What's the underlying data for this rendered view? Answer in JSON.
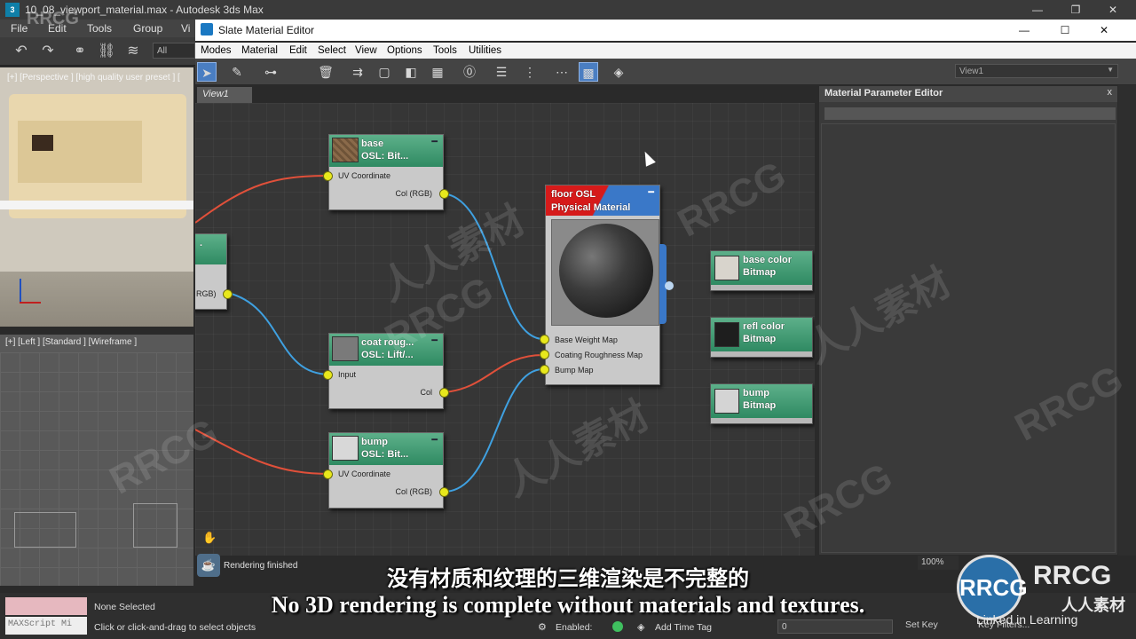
{
  "window": {
    "title": "10_08_viewport_material.max - Autodesk 3ds Max",
    "logo": "3",
    "buttons": {
      "minimize": "—",
      "restore": "❐",
      "close": "✕"
    }
  },
  "max_menu": {
    "file": "File",
    "edit": "Edit",
    "tools": "Tools",
    "group": "Group",
    "views": "Vi"
  },
  "max_toolbar": {
    "selection_filter": "All",
    "icons": [
      "undo-icon",
      "redo-icon",
      "link-icon",
      "unlink-icon",
      "bind-spacewarp-icon"
    ]
  },
  "viewports": {
    "perspective_label": "[+] [Perspective ] [high quality user preset ] [",
    "left_label": "[+] [Left ] [Standard ] [Wireframe ]"
  },
  "slate": {
    "title": "Slate Material Editor",
    "buttons": {
      "minimize": "—",
      "maximize": "☐",
      "close": "✕"
    },
    "menu": [
      "Modes",
      "Material",
      "Edit",
      "Select",
      "View",
      "Options",
      "Tools",
      "Utilities"
    ],
    "view_dropdown": "View1",
    "view_tab": "View1",
    "toolbar_icons": [
      "select-icon",
      "eyedropper-icon",
      "assign-icon",
      "delete-icon",
      "move-children-icon",
      "hide-icon",
      "layout-icon",
      "show-map-icon",
      "zero-icon",
      "layout-all-icon",
      "layout-children-icon",
      "material-id-icon",
      "background-icon",
      "options-icon"
    ]
  },
  "nodes": {
    "base": {
      "name": "base",
      "type": "OSL: Bit...",
      "in_slot": "UV Coordinate",
      "out_slot": "Col (RGB)"
    },
    "coat": {
      "name": "coat roug...",
      "type": "OSL: Lift/...",
      "in_slot": "Input",
      "out_slot": "Col"
    },
    "bump": {
      "name": "bump",
      "type": "OSL: Bit...",
      "in_slot": "UV Coordinate",
      "out_slot": "Col (RGB)"
    },
    "partial": {
      "top_label": ".",
      "out_slot": "RGB)"
    },
    "material": {
      "name": "floor OSL",
      "type": "Physical Material",
      "slots": [
        "Base Weight Map",
        "Coating Roughness Map",
        "Bump Map"
      ]
    },
    "side": [
      {
        "name": "base color",
        "type": "Bitmap",
        "thumb": "#d8d4cc"
      },
      {
        "name": "refl color",
        "type": "Bitmap",
        "thumb": "#1e1e1e"
      },
      {
        "name": "bump",
        "type": "Bitmap",
        "thumb": "#d4d4d4"
      }
    ]
  },
  "param_editor": {
    "title": "Material Parameter Editor",
    "close": "x"
  },
  "status": {
    "rendering": "Rendering finished",
    "zoom": "100%",
    "script_label": "MAXScript Mi",
    "none_selected": "None Selected",
    "hint": "Click or click-and-drag to select objects",
    "enabled": "Enabled:",
    "add_time_tag": "Add Time Tag",
    "frame": "0",
    "set_key": "Set Key",
    "key_filters": "Key Filters..."
  },
  "subtitles": {
    "cn": "没有材质和纹理的三维渲染是不完整的",
    "en": "No 3D rendering is complete without materials and textures."
  },
  "watermark": {
    "brand": "RRCG",
    "cn": "人人素材",
    "logo_text": "RRCG",
    "logo_sub": "人人素材",
    "linkedin": "Linked in Learning",
    "corner": "RRCG"
  },
  "colors": {
    "wire_red": "#e0503a",
    "wire_blue": "#3fa0e0",
    "socket": "#e8e81c",
    "node_header": "#3a9a6e"
  }
}
